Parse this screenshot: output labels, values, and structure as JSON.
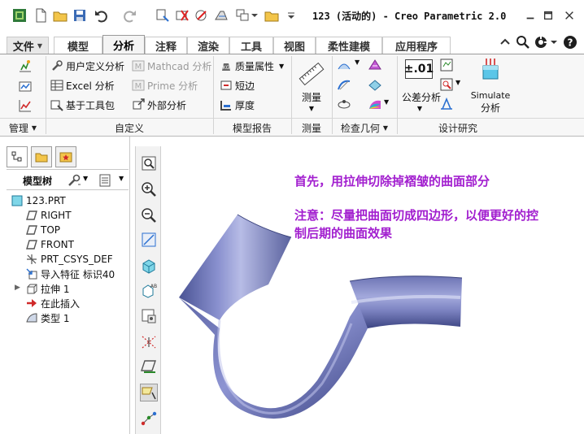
{
  "title": {
    "app_title": "123 (活动的) - Creo Parametric 2.0"
  },
  "tabs": [
    {
      "label": "文件"
    },
    {
      "label": "模型"
    },
    {
      "label": "分析"
    },
    {
      "label": "注释"
    },
    {
      "label": "渲染"
    },
    {
      "label": "工具"
    },
    {
      "label": "视图"
    },
    {
      "label": "柔性建模"
    },
    {
      "label": "应用程序"
    }
  ],
  "ribbon": {
    "buttons": {
      "user_defined": "用户定义分析",
      "mathcad": "Mathcad 分析",
      "mass_props": "质量属性",
      "excel": "Excel 分析",
      "prime": "Prime 分析",
      "short_edge": "短边",
      "toolkit": "基于工具包",
      "external": "外部分析",
      "thickness": "厚度",
      "measure": "测量",
      "tolerance": "公差分析",
      "tolerance_value": "±.01",
      "simulate": "Simulate",
      "simulate_sub": "分析"
    },
    "groups": {
      "manage": "管理",
      "custom": "自定义",
      "model_report": "模型报告",
      "measure": "测量",
      "inspect_geometry": "检查几何",
      "design_study": "设计研究"
    }
  },
  "panel": {
    "tree_title": "模型树",
    "tree_items": [
      {
        "label": "123.PRT"
      },
      {
        "label": "RIGHT"
      },
      {
        "label": "TOP"
      },
      {
        "label": "FRONT"
      },
      {
        "label": "PRT_CSYS_DEF"
      },
      {
        "label": "导入特征 标识40"
      },
      {
        "label": "拉伸 1"
      },
      {
        "label": "在此插入"
      },
      {
        "label": "类型 1"
      }
    ]
  },
  "notes": {
    "line1": "首先，用拉伸切除掉褶皱的曲面部分",
    "line2a": "注意：尽量把曲面切成四边形，以便更好的控",
    "line2b": "制后期的曲面效果"
  },
  "colors": {
    "note_text": "#a21fcf",
    "surface": "#7b82bf",
    "accent_tab": "#f4f4f4"
  }
}
